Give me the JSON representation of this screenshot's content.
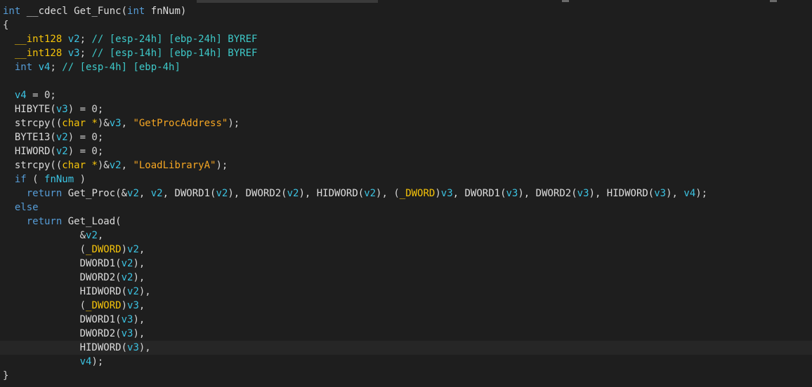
{
  "editor": {
    "lines": [
      [
        {
          "t": "int",
          "c": "kw"
        },
        {
          "t": " __cdecl Get_Func(",
          "c": "fn"
        },
        {
          "t": "int",
          "c": "kw"
        },
        {
          "t": " fnNum)",
          "c": "fn"
        }
      ],
      [
        {
          "t": "{",
          "c": "pun"
        }
      ],
      [
        {
          "t": "  __int128 ",
          "c": "type"
        },
        {
          "t": "v2",
          "c": "var"
        },
        {
          "t": "; ",
          "c": "pun"
        },
        {
          "t": "// [esp-24h] [ebp-24h] BYREF",
          "c": "cmt"
        }
      ],
      [
        {
          "t": "  __int128 ",
          "c": "type"
        },
        {
          "t": "v3",
          "c": "var"
        },
        {
          "t": "; ",
          "c": "pun"
        },
        {
          "t": "// [esp-14h] [ebp-14h] BYREF",
          "c": "cmt"
        }
      ],
      [
        {
          "t": "  int ",
          "c": "kw"
        },
        {
          "t": "v4",
          "c": "var"
        },
        {
          "t": "; ",
          "c": "pun"
        },
        {
          "t": "// [esp-4h] [ebp-4h]",
          "c": "cmt"
        }
      ],
      [
        {
          "t": "",
          "c": "pun"
        }
      ],
      [
        {
          "t": "  ",
          "c": "pun"
        },
        {
          "t": "v4",
          "c": "var"
        },
        {
          "t": " = 0;",
          "c": "pun"
        }
      ],
      [
        {
          "t": "  HIBYTE(",
          "c": "fn"
        },
        {
          "t": "v3",
          "c": "var"
        },
        {
          "t": ") = 0;",
          "c": "pun"
        }
      ],
      [
        {
          "t": "  strcpy((",
          "c": "fn"
        },
        {
          "t": "char *",
          "c": "type"
        },
        {
          "t": ")&",
          "c": "pun"
        },
        {
          "t": "v3",
          "c": "var"
        },
        {
          "t": ", ",
          "c": "pun"
        },
        {
          "t": "\"GetProcAddress\"",
          "c": "str"
        },
        {
          "t": ");",
          "c": "pun"
        }
      ],
      [
        {
          "t": "  BYTE13(",
          "c": "fn"
        },
        {
          "t": "v2",
          "c": "var"
        },
        {
          "t": ") = 0;",
          "c": "pun"
        }
      ],
      [
        {
          "t": "  HIWORD(",
          "c": "fn"
        },
        {
          "t": "v2",
          "c": "var"
        },
        {
          "t": ") = 0;",
          "c": "pun"
        }
      ],
      [
        {
          "t": "  strcpy((",
          "c": "fn"
        },
        {
          "t": "char *",
          "c": "type"
        },
        {
          "t": ")&",
          "c": "pun"
        },
        {
          "t": "v2",
          "c": "var"
        },
        {
          "t": ", ",
          "c": "pun"
        },
        {
          "t": "\"LoadLibraryA\"",
          "c": "str"
        },
        {
          "t": ");",
          "c": "pun"
        }
      ],
      [
        {
          "t": "  if",
          "c": "kw"
        },
        {
          "t": " ( ",
          "c": "pun"
        },
        {
          "t": "fnNum",
          "c": "var"
        },
        {
          "t": " )",
          "c": "pun"
        }
      ],
      [
        {
          "t": "    return",
          "c": "kw"
        },
        {
          "t": " Get_Proc(&",
          "c": "fn"
        },
        {
          "t": "v2",
          "c": "var"
        },
        {
          "t": ", ",
          "c": "pun"
        },
        {
          "t": "v2",
          "c": "var"
        },
        {
          "t": ", DWORD1(",
          "c": "fn"
        },
        {
          "t": "v2",
          "c": "var"
        },
        {
          "t": "), DWORD2(",
          "c": "fn"
        },
        {
          "t": "v2",
          "c": "var"
        },
        {
          "t": "), HIDWORD(",
          "c": "fn"
        },
        {
          "t": "v2",
          "c": "var"
        },
        {
          "t": "), (",
          "c": "pun"
        },
        {
          "t": "_DWORD",
          "c": "type"
        },
        {
          "t": ")",
          "c": "pun"
        },
        {
          "t": "v3",
          "c": "var"
        },
        {
          "t": ", DWORD1(",
          "c": "fn"
        },
        {
          "t": "v3",
          "c": "var"
        },
        {
          "t": "), DWORD2(",
          "c": "fn"
        },
        {
          "t": "v3",
          "c": "var"
        },
        {
          "t": "), HIDWORD(",
          "c": "fn"
        },
        {
          "t": "v3",
          "c": "var"
        },
        {
          "t": "), ",
          "c": "pun"
        },
        {
          "t": "v4",
          "c": "var"
        },
        {
          "t": ");",
          "c": "pun"
        }
      ],
      [
        {
          "t": "  else",
          "c": "kw"
        }
      ],
      [
        {
          "t": "    return",
          "c": "kw"
        },
        {
          "t": " Get_Load(",
          "c": "fn"
        }
      ],
      [
        {
          "t": "             &",
          "c": "pun"
        },
        {
          "t": "v2",
          "c": "var"
        },
        {
          "t": ",",
          "c": "pun"
        }
      ],
      [
        {
          "t": "             (",
          "c": "pun"
        },
        {
          "t": "_DWORD",
          "c": "type"
        },
        {
          "t": ")",
          "c": "pun"
        },
        {
          "t": "v2",
          "c": "var"
        },
        {
          "t": ",",
          "c": "pun"
        }
      ],
      [
        {
          "t": "             DWORD1(",
          "c": "fn"
        },
        {
          "t": "v2",
          "c": "var"
        },
        {
          "t": "),",
          "c": "pun"
        }
      ],
      [
        {
          "t": "             DWORD2(",
          "c": "fn"
        },
        {
          "t": "v2",
          "c": "var"
        },
        {
          "t": "),",
          "c": "pun"
        }
      ],
      [
        {
          "t": "             HIDWORD(",
          "c": "fn"
        },
        {
          "t": "v2",
          "c": "var"
        },
        {
          "t": "),",
          "c": "pun"
        }
      ],
      [
        {
          "t": "             (",
          "c": "pun"
        },
        {
          "t": "_DWORD",
          "c": "type"
        },
        {
          "t": ")",
          "c": "pun"
        },
        {
          "t": "v3",
          "c": "var"
        },
        {
          "t": ",",
          "c": "pun"
        }
      ],
      [
        {
          "t": "             DWORD1(",
          "c": "fn"
        },
        {
          "t": "v3",
          "c": "var"
        },
        {
          "t": "),",
          "c": "pun"
        }
      ],
      [
        {
          "t": "             DWORD2(",
          "c": "fn"
        },
        {
          "t": "v3",
          "c": "var"
        },
        {
          "t": "),",
          "c": "pun"
        }
      ],
      [
        {
          "t": "             HIDWORD(",
          "c": "fn"
        },
        {
          "t": "v3",
          "c": "var"
        },
        {
          "t": "),",
          "c": "pun"
        }
      ],
      [
        {
          "t": "             ",
          "c": "pun"
        },
        {
          "t": "v4",
          "c": "var"
        },
        {
          "t": ");",
          "c": "pun"
        }
      ],
      [
        {
          "t": "}",
          "c": "pun"
        }
      ]
    ],
    "cursor_line": 24
  },
  "colors": {
    "background": "#1e1e1e",
    "keyword": "#569cd6",
    "type": "#f5c30a",
    "comment": "#3ec9c9",
    "string": "#f5a623",
    "variable": "#3cc3e2",
    "text": "#d4d4d4"
  }
}
